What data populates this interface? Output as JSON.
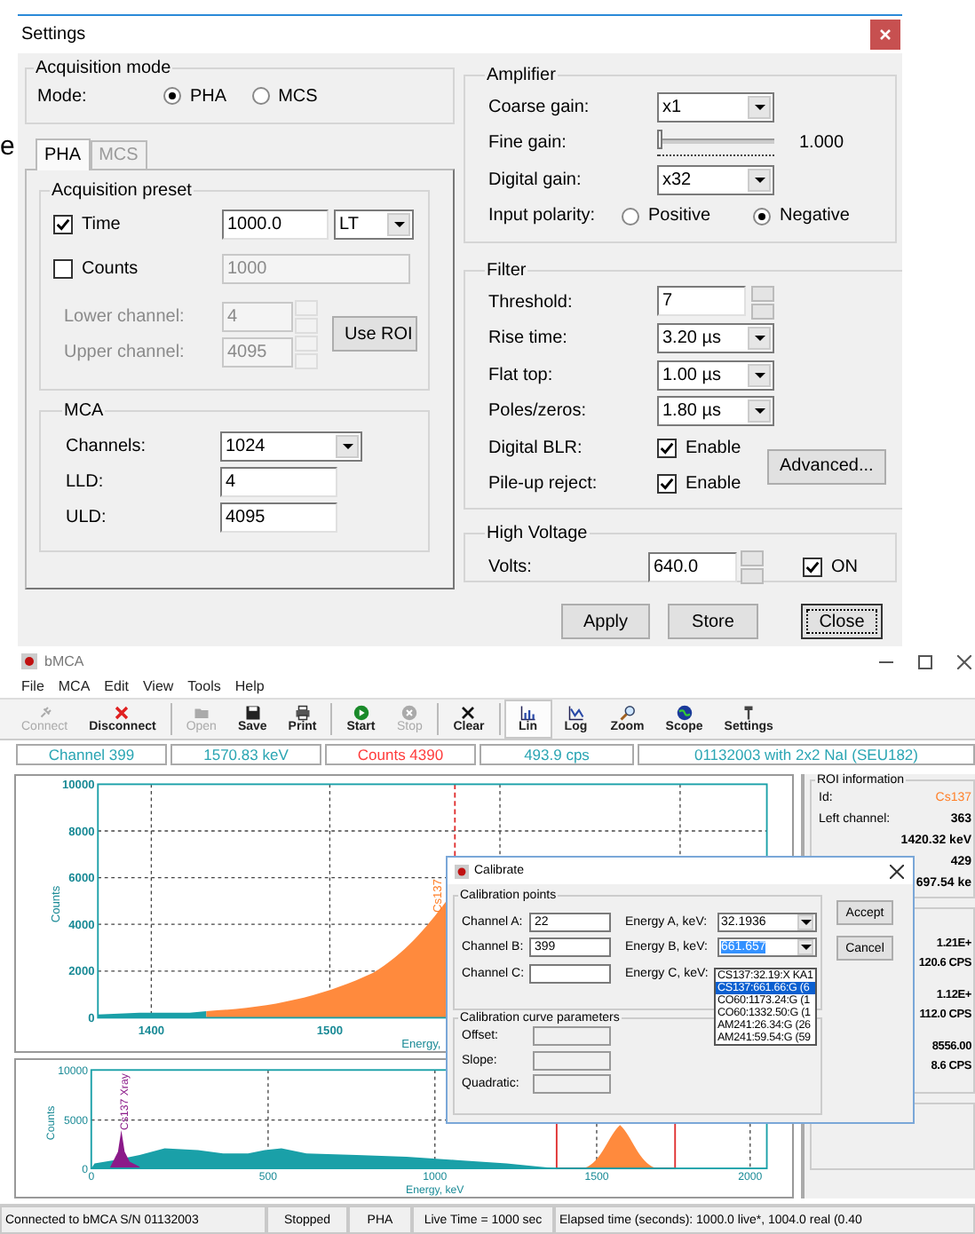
{
  "background_text": "e",
  "settings": {
    "title": "Settings",
    "acquisition_mode": {
      "title": "Acquisition mode",
      "label": "Mode:",
      "options": [
        {
          "label": "PHA",
          "selected": true
        },
        {
          "label": "MCS",
          "selected": false
        }
      ]
    },
    "tabs": [
      {
        "label": "PHA",
        "selected": true,
        "disabled": false
      },
      {
        "label": "MCS",
        "selected": false,
        "disabled": true
      }
    ],
    "acquisition_preset": {
      "title": "Acquisition preset",
      "time": {
        "label": "Time",
        "checked": true,
        "value": "1000.0",
        "unit": "LT"
      },
      "counts": {
        "label": "Counts",
        "checked": false,
        "value": "1000"
      },
      "lower_channel": {
        "label": "Lower channel:",
        "value": "4"
      },
      "upper_channel": {
        "label": "Upper channel:",
        "value": "4095"
      },
      "use_roi_button": "Use ROI"
    },
    "mca": {
      "title": "MCA",
      "rows": [
        {
          "kind": "dropdown",
          "label": "Channels:",
          "value": "1024"
        },
        {
          "kind": "text",
          "label": "LLD:",
          "value": "4"
        },
        {
          "kind": "text",
          "label": "ULD:",
          "value": "4095"
        }
      ]
    },
    "amplifier": {
      "title": "Amplifier",
      "rows": [
        {
          "kind": "dropdown",
          "label": "Coarse gain:",
          "value": "x1"
        },
        {
          "kind": "slider",
          "label": "Fine gain:",
          "level": 0,
          "reading": "1.000"
        },
        {
          "kind": "dropdown",
          "label": "Digital gain:",
          "value": "x32"
        },
        {
          "kind": "radio",
          "label": "Input polarity:",
          "options": [
            {
              "label": "Positive",
              "selected": false
            },
            {
              "label": "Negative",
              "selected": true
            }
          ]
        }
      ]
    },
    "filter": {
      "title": "Filter",
      "rows": [
        {
          "kind": "spin",
          "label": "Threshold:",
          "value": "7"
        },
        {
          "kind": "dropdown",
          "label": "Rise time:",
          "value": "3.20 µs"
        },
        {
          "kind": "dropdown",
          "label": "Flat top:",
          "value": "1.00 µs"
        },
        {
          "kind": "dropdown",
          "label": "Poles/zeros:",
          "value": "1.80 µs"
        },
        {
          "kind": "checkbox",
          "label": "Digital BLR:",
          "option": "Enable",
          "checked": true
        },
        {
          "kind": "checkbox",
          "label": "Pile-up reject:",
          "option": "Enable",
          "checked": true
        }
      ],
      "advanced_button": "Advanced..."
    },
    "high_voltage": {
      "title": "High Voltage",
      "label": "Volts:",
      "value": "640.0",
      "on": {
        "label": "ON",
        "checked": true
      }
    },
    "buttons": [
      {
        "label": "Apply",
        "focused": false
      },
      {
        "label": "Store",
        "focused": false
      },
      {
        "label": "Close",
        "focused": true
      }
    ]
  },
  "bmca": {
    "title": "bMCA",
    "menu": [
      "File",
      "MCA",
      "Edit",
      "View",
      "Tools",
      "Help"
    ],
    "toolbar": [
      {
        "kind": "plug",
        "label": "Connect",
        "disabled": true,
        "selected": false
      },
      {
        "kind": "cross",
        "label": "Disconnect",
        "disabled": false,
        "selected": false
      },
      {
        "kind": "separator"
      },
      {
        "kind": "folder",
        "label": "Open",
        "disabled": true,
        "selected": false
      },
      {
        "kind": "floppy",
        "label": "Save",
        "disabled": false,
        "selected": false
      },
      {
        "kind": "printer",
        "label": "Print",
        "disabled": false,
        "selected": false
      },
      {
        "kind": "separator"
      },
      {
        "kind": "play",
        "label": "Start",
        "disabled": false,
        "selected": false
      },
      {
        "kind": "stop",
        "label": "Stop",
        "disabled": true,
        "selected": false
      },
      {
        "kind": "separator"
      },
      {
        "kind": "clear",
        "label": "Clear",
        "disabled": false,
        "selected": false
      },
      {
        "kind": "separator"
      },
      {
        "kind": "lin",
        "label": "Lin",
        "disabled": false,
        "selected": true
      },
      {
        "kind": "log",
        "label": "Log",
        "disabled": false,
        "selected": false
      },
      {
        "kind": "zoom",
        "label": "Zoom",
        "disabled": false,
        "selected": false
      },
      {
        "kind": "globe",
        "label": "Scope",
        "disabled": false,
        "selected": false
      },
      {
        "kind": "antenna",
        "label": "Settings",
        "disabled": false,
        "selected": false
      }
    ],
    "readouts": [
      {
        "text": "Channel 399",
        "color": "#2aa5b3"
      },
      {
        "text": "1570.83 keV",
        "color": "#2aa5b3"
      },
      {
        "text": "Counts 4390",
        "color": "#ff3b3b"
      },
      {
        "text": "493.9 cps",
        "color": "#2aa5b3"
      },
      {
        "text": "01132003 with 2x2 NaI (SEU182)",
        "color": "#2aa5b3"
      }
    ],
    "main_plot": {
      "y_tick_labels": [
        "10000",
        "8000",
        "6000",
        "4000",
        "2000",
        "0"
      ],
      "x_tick_labels": [
        "1400",
        "1500"
      ],
      "ylabel": "Counts",
      "xlabel": "Energy,",
      "peak_label": "Cs137"
    },
    "overview_plot": {
      "y_tick_labels": [
        "10000",
        "5000",
        "0"
      ],
      "x_tick_labels": [
        "0",
        "500",
        "1000",
        "1500",
        "2000"
      ],
      "ylabel": "Counts",
      "xlabel": "Energy, keV",
      "peak_label": "Cs137 Xray"
    },
    "roi_panel": {
      "title": "ROI information",
      "rows": [
        {
          "kind": "id",
          "label": "Id:",
          "value": "Cs137"
        },
        {
          "kind": "value",
          "label": "Left channel:",
          "value": "363"
        },
        {
          "kind": "value",
          "value": "1420.32 keV"
        },
        {
          "kind": "value",
          "value": "429"
        },
        {
          "kind": "value",
          "value": "697.54 ke"
        }
      ],
      "stats": [
        "1.21E+",
        "120.6 CPS",
        "1.12E+",
        "112.0 CPS",
        "8556.00",
        "8.6 CPS"
      ]
    },
    "status_bar": [
      "Connected to bMCA S/N 01132003",
      "Stopped",
      "PHA",
      "Live Time = 1000 sec",
      "Elapsed time (seconds): 1000.0 live*, 1004.0 real (0.40"
    ]
  },
  "calibrate": {
    "title": "Calibrate",
    "points": {
      "title": "Calibration points",
      "rows": [
        {
          "channel_label": "Channel A:",
          "channel_value": "22",
          "energy_label": "Energy A, keV:",
          "energy_value": "32.1936",
          "text_selected": false
        },
        {
          "channel_label": "Channel B:",
          "channel_value": "399",
          "energy_label": "Energy B, keV:",
          "energy_value": "661.657",
          "text_selected": true
        },
        {
          "channel_label": "Channel C:",
          "channel_value": "",
          "energy_label": "Energy C, keV:"
        }
      ]
    },
    "energy_list": [
      {
        "text": "CS137:32.19:X KA1",
        "selected": false
      },
      {
        "text": "CS137:661.66:G (6",
        "selected": true
      },
      {
        "text": "CO60:1173.24:G (1",
        "selected": false
      },
      {
        "text": "CO60:1332.50:G (1",
        "selected": false
      },
      {
        "text": "AM241:26.34:G (26",
        "selected": false
      },
      {
        "text": "AM241:59.54:G (59",
        "selected": false
      }
    ],
    "curve": {
      "title": "Calibration curve parameters",
      "rows": [
        "Offset:",
        "Slope:",
        "Quadratic:"
      ]
    },
    "buttons": [
      "Accept",
      "Cancel"
    ]
  }
}
